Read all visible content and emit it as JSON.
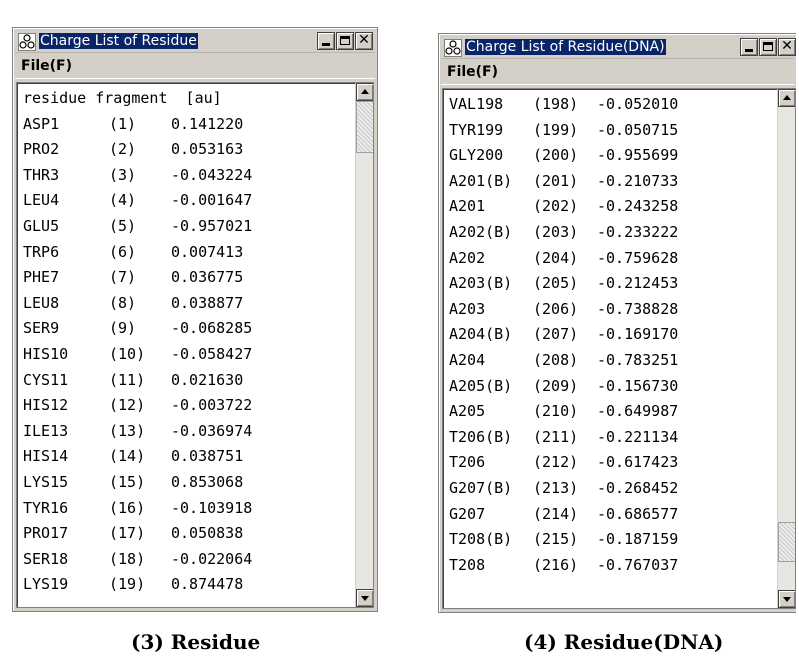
{
  "windows": {
    "left": {
      "title": "Charge List of Residue",
      "menu_file": "File(F)",
      "header": "residue fragment  [au]",
      "rows": [
        [
          "ASP1",
          "(1)",
          "0.141220"
        ],
        [
          "PRO2",
          "(2)",
          "0.053163"
        ],
        [
          "THR3",
          "(3)",
          "-0.043224"
        ],
        [
          "LEU4",
          "(4)",
          "-0.001647"
        ],
        [
          "GLU5",
          "(5)",
          "-0.957021"
        ],
        [
          "TRP6",
          "(6)",
          "0.007413"
        ],
        [
          "PHE7",
          "(7)",
          "0.036775"
        ],
        [
          "LEU8",
          "(8)",
          "0.038877"
        ],
        [
          "SER9",
          "(9)",
          "-0.068285"
        ],
        [
          "HIS10",
          "(10)",
          "-0.058427"
        ],
        [
          "CYS11",
          "(11)",
          "0.021630"
        ],
        [
          "HIS12",
          "(12)",
          "-0.003722"
        ],
        [
          "ILE13",
          "(13)",
          "-0.036974"
        ],
        [
          "HIS14",
          "(14)",
          "0.038751"
        ],
        [
          "LYS15",
          "(15)",
          "0.853068"
        ],
        [
          "TYR16",
          "(16)",
          "-0.103918"
        ],
        [
          "PRO17",
          "(17)",
          "0.050838"
        ],
        [
          "SER18",
          "(18)",
          "-0.022064"
        ],
        [
          "LYS19",
          "(19)",
          "0.874478"
        ]
      ]
    },
    "right": {
      "title": "Charge List of Residue(DNA)",
      "menu_file": "File(F)",
      "rows": [
        [
          "VAL198",
          "(198)",
          "-0.052010"
        ],
        [
          "TYR199",
          "(199)",
          "-0.050715"
        ],
        [
          "GLY200",
          "(200)",
          "-0.955699"
        ],
        [
          "A201(B)",
          "(201)",
          "-0.210733"
        ],
        [
          "A201",
          "(202)",
          "-0.243258"
        ],
        [
          "A202(B)",
          "(203)",
          "-0.233222"
        ],
        [
          "A202",
          "(204)",
          "-0.759628"
        ],
        [
          "A203(B)",
          "(205)",
          "-0.212453"
        ],
        [
          "A203",
          "(206)",
          "-0.738828"
        ],
        [
          "A204(B)",
          "(207)",
          "-0.169170"
        ],
        [
          "A204",
          "(208)",
          "-0.783251"
        ],
        [
          "A205(B)",
          "(209)",
          "-0.156730"
        ],
        [
          "A205",
          "(210)",
          "-0.649987"
        ],
        [
          "T206(B)",
          "(211)",
          "-0.221134"
        ],
        [
          "T206",
          "(212)",
          "-0.617423"
        ],
        [
          "G207(B)",
          "(213)",
          "-0.268452"
        ],
        [
          "G207",
          "(214)",
          "-0.686577"
        ],
        [
          "T208(B)",
          "(215)",
          "-0.187159"
        ],
        [
          "T208",
          "(216)",
          "-0.767037"
        ]
      ]
    }
  },
  "captions": {
    "left": "(3) Residue",
    "right": "(4) Residue(DNA)"
  },
  "icons": {
    "app": "molecule-icon",
    "minimize": "minimize-icon",
    "maximize": "maximize-icon",
    "close": "close-icon",
    "scroll_up": "scroll-up-arrow-icon",
    "scroll_down": "scroll-down-arrow-icon"
  },
  "colors": {
    "title_highlight": "#0a246a",
    "window_face": "#d4d0c8"
  }
}
